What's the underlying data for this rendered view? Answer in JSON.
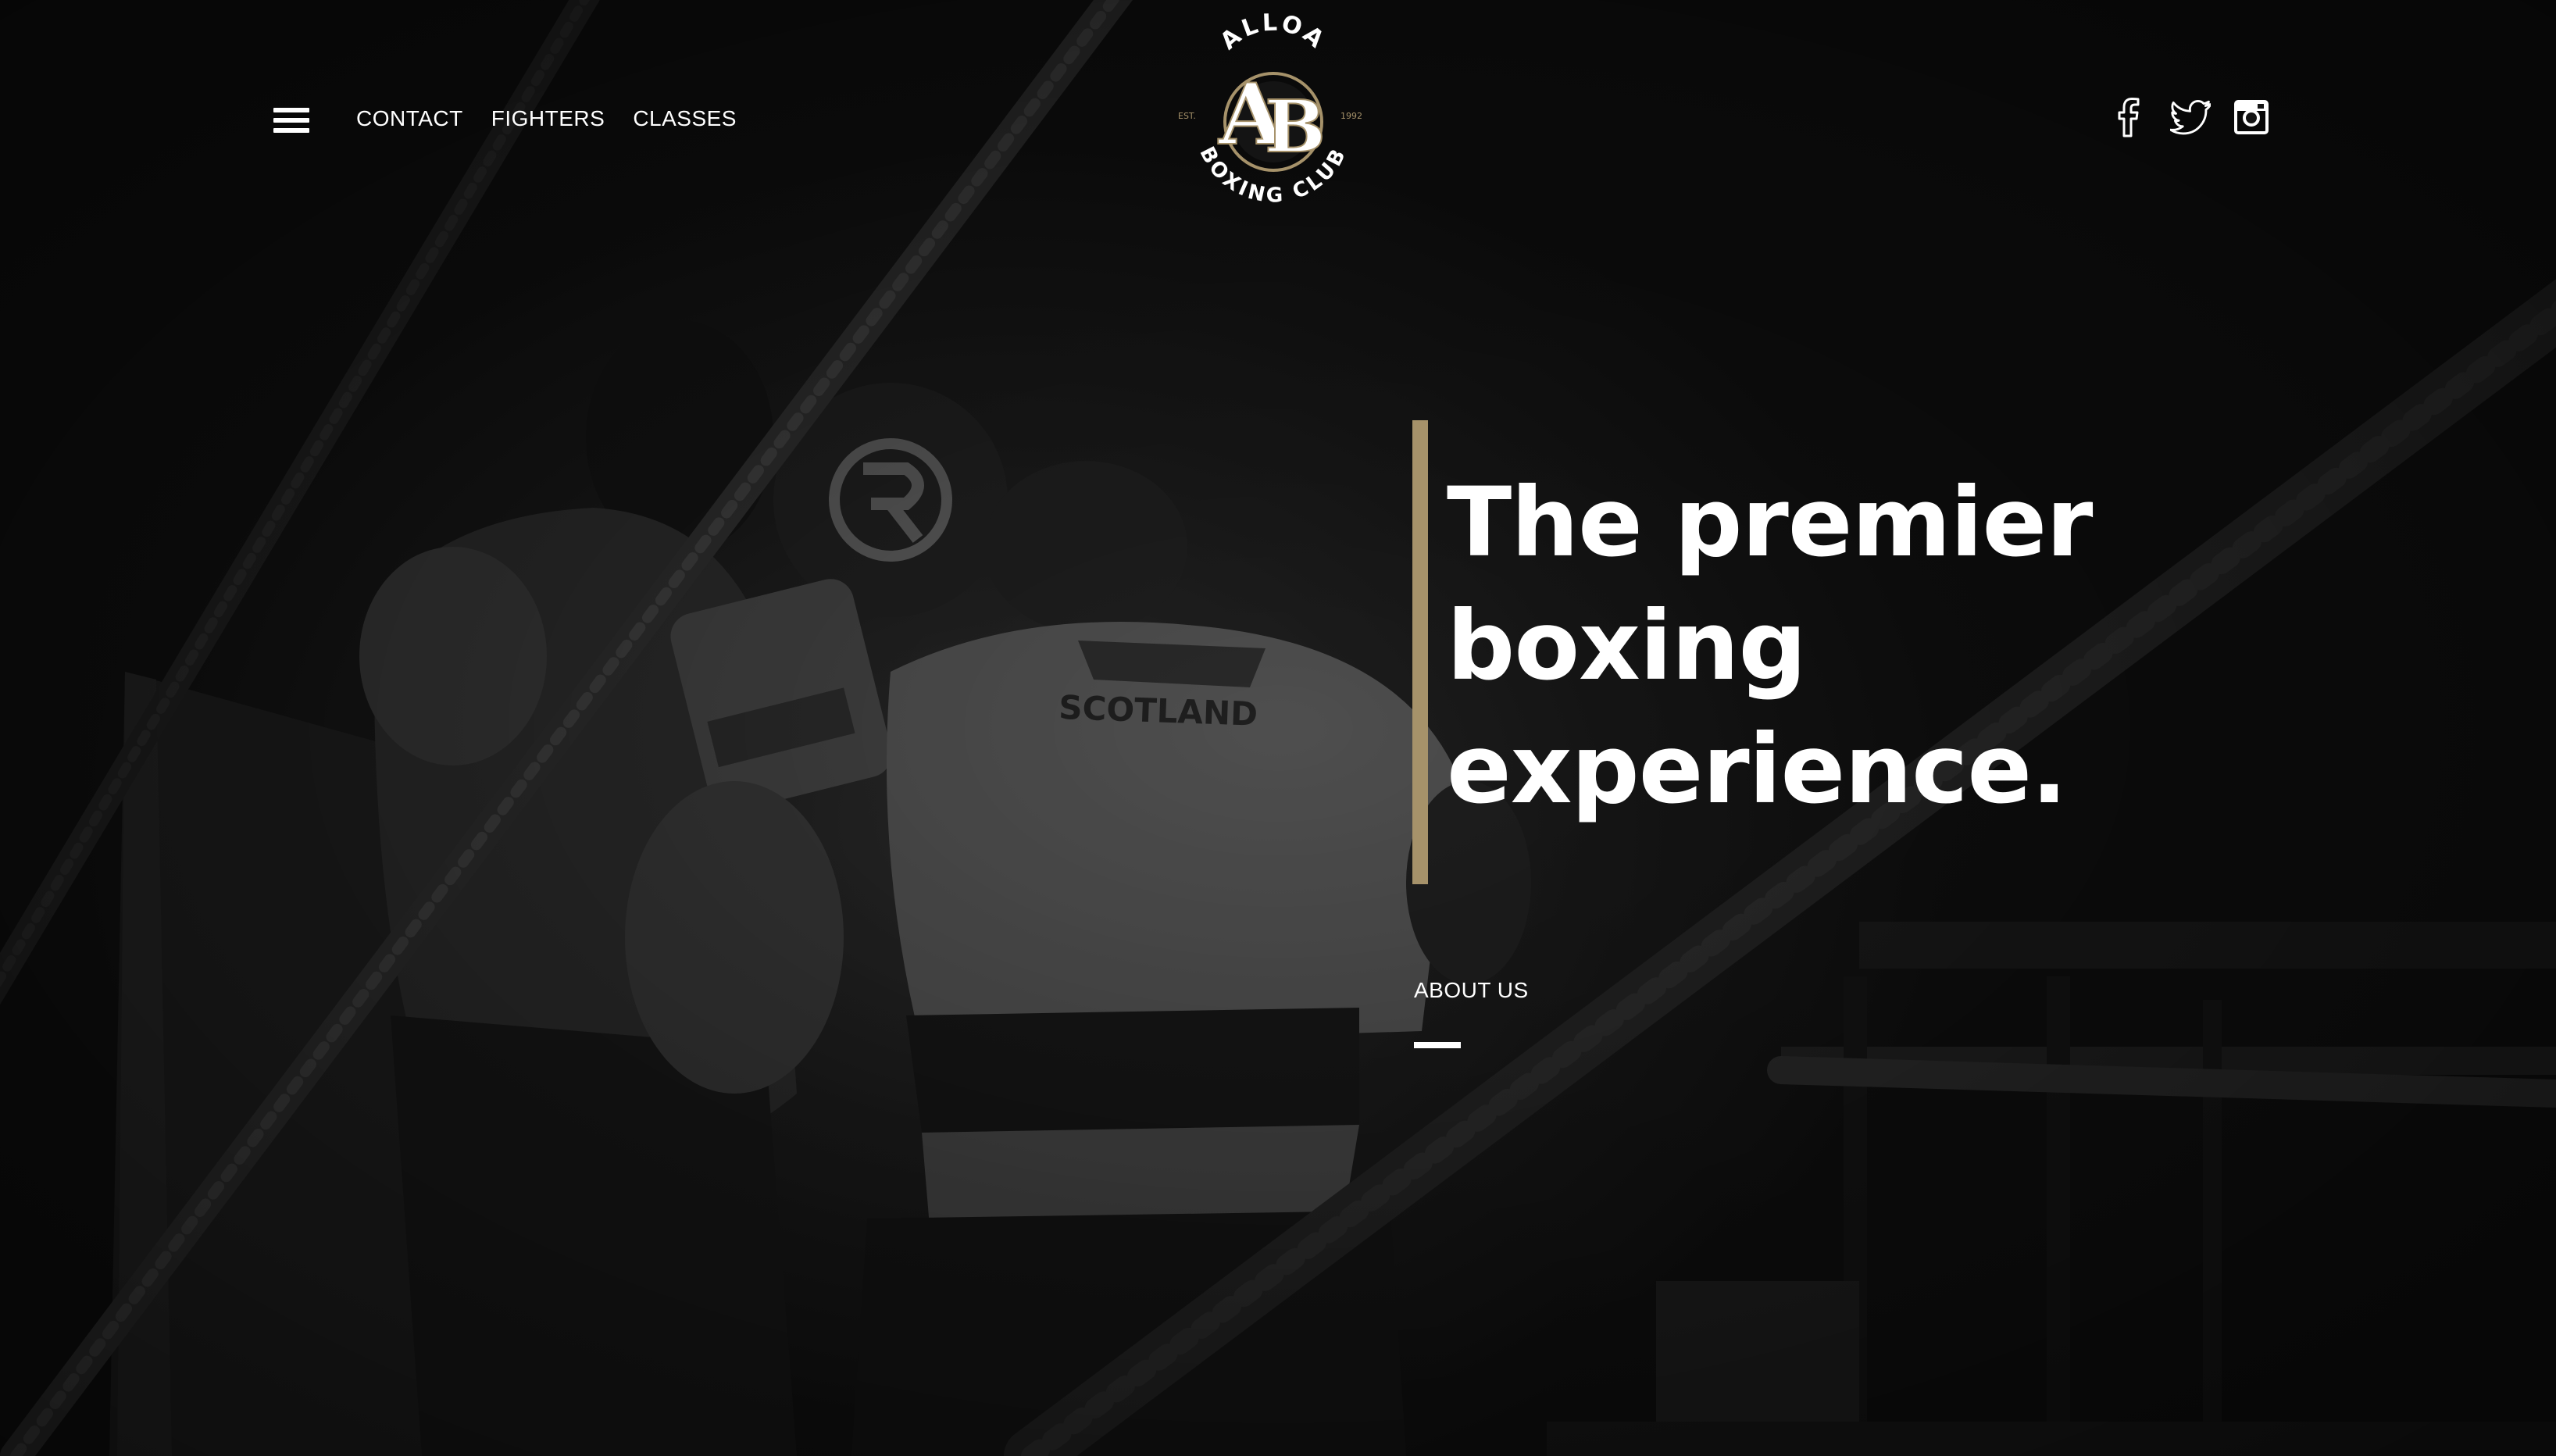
{
  "nav": {
    "menu_icon": "hamburger-menu-icon",
    "links": [
      {
        "label": "CONTACT"
      },
      {
        "label": "FIGHTERS"
      },
      {
        "label": "CLASSES"
      }
    ]
  },
  "logo": {
    "top_text": "ALLOA",
    "bottom_text": "BOXING CLUB",
    "monogram": "AB",
    "est_label": "EST.",
    "est_year": "1992"
  },
  "social": {
    "facebook": "facebook-icon",
    "twitter": "twitter-icon",
    "instagram": "instagram-icon"
  },
  "hero": {
    "headline_lines": [
      "The premier",
      "boxing",
      "experience."
    ],
    "about_label": "ABOUT US",
    "vest_text": "SCOTLAND",
    "accent_color": "#a6926a"
  }
}
